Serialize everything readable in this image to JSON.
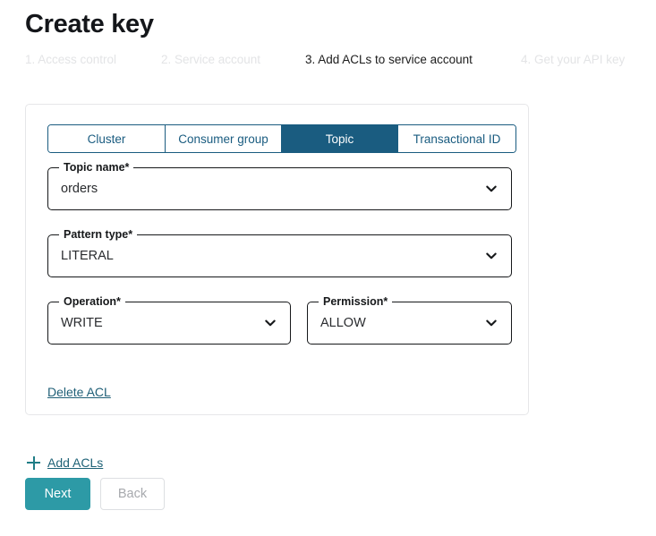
{
  "page": {
    "title": "Create key"
  },
  "stepper": {
    "steps": [
      {
        "label": "1. Access control",
        "state": "inactive"
      },
      {
        "label": "2. Service account",
        "state": "inactive"
      },
      {
        "label": "3. Add ACLs to service account",
        "state": "active"
      },
      {
        "label": "4. Get your API key",
        "state": "inactive"
      }
    ]
  },
  "acl_card": {
    "tabs": [
      {
        "label": "Cluster",
        "selected": false
      },
      {
        "label": "Consumer group",
        "selected": false
      },
      {
        "label": "Topic",
        "selected": true
      },
      {
        "label": "Transactional ID",
        "selected": false
      }
    ],
    "fields": {
      "topic_name": {
        "label": "Topic name*",
        "value": "orders",
        "icon": "chevron-down-icon"
      },
      "pattern_type": {
        "label": "Pattern type*",
        "value": "LITERAL",
        "icon": "chevron-down-icon"
      },
      "operation": {
        "label": "Operation*",
        "value": "WRITE",
        "icon": "chevron-down-icon"
      },
      "permission": {
        "label": "Permission*",
        "value": "ALLOW",
        "icon": "chevron-down-icon"
      }
    },
    "delete_link": "Delete ACL"
  },
  "footer": {
    "add_acls_label": "Add ACLs",
    "add_acls_icon": "plus-icon",
    "next_label": "Next",
    "back_label": "Back"
  },
  "colors": {
    "tab_selected_bg": "#1a5c80",
    "tab_text": "#1a5c80",
    "next_button_bg": "#2d9aa6",
    "link_teal": "#1f6277",
    "plus_teal": "#1f7d86",
    "step_inactive": "#e3e4e6",
    "step_active": "#1b1b1b",
    "card_border": "#e6e7e9",
    "field_border": "#16181a",
    "back_button_text": "#a7a9ad",
    "back_button_border": "#dddfe2"
  }
}
